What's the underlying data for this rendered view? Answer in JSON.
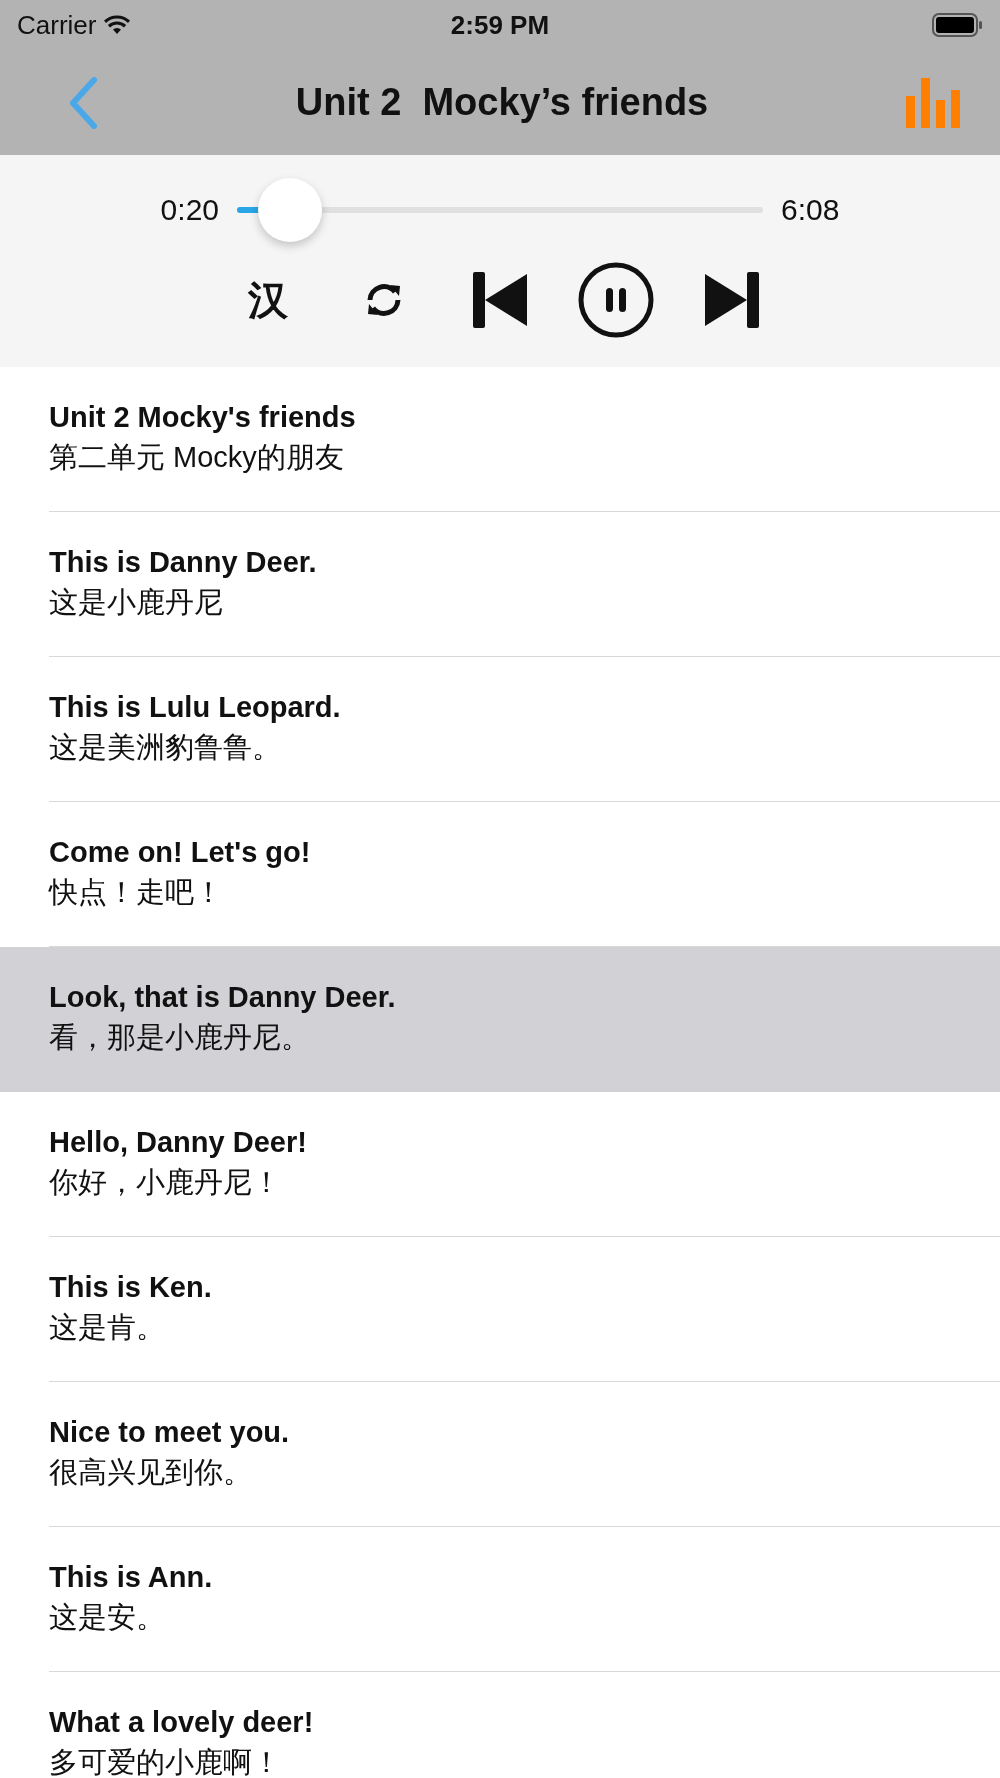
{
  "status_bar": {
    "carrier": "Carrier",
    "time": "2:59 PM"
  },
  "nav": {
    "title": "Unit 2  Mocky’s friends"
  },
  "player": {
    "elapsed": "0:20",
    "duration": "6:08",
    "level": 0.1,
    "translate_label": "汉",
    "playing": true
  },
  "sentences": [
    {
      "english": "Unit 2 Mocky's friends",
      "chinese": "第二单元 Mocky的朋友",
      "selected": false
    },
    {
      "english": "This is Danny Deer.",
      "chinese": "这是小鹿丹尼",
      "selected": false
    },
    {
      "english": "This is Lulu Leopard.",
      "chinese": "这是美洲豹鲁鲁。",
      "selected": false
    },
    {
      "english": "Come on! Let's go!",
      "chinese": "快点！走吧！",
      "selected": false
    },
    {
      "english": "Look, that is Danny Deer.",
      "chinese": "看，那是小鹿丹尼。",
      "selected": true
    },
    {
      "english": "Hello, Danny Deer!",
      "chinese": "你好，小鹿丹尼！",
      "selected": false
    },
    {
      "english": "This is Ken.",
      "chinese": "这是肯。",
      "selected": false
    },
    {
      "english": "Nice to meet you.",
      "chinese": "很高兴见到你。",
      "selected": false
    },
    {
      "english": "This is Ann.",
      "chinese": "这是安。",
      "selected": false
    },
    {
      "english": "What a lovely deer!",
      "chinese": "多可爱的小鹿啊！",
      "selected": false
    }
  ]
}
